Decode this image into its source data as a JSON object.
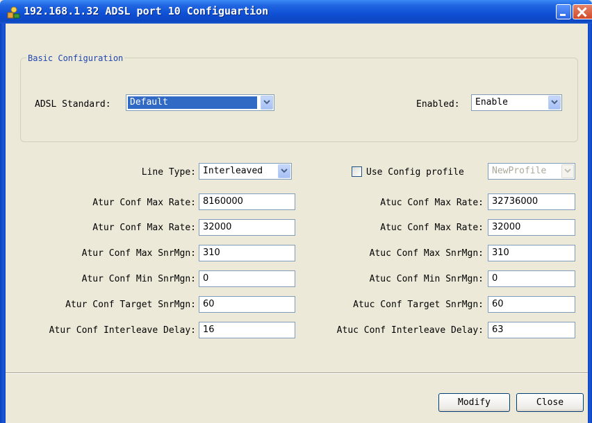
{
  "window": {
    "title": "192.168.1.32 ADSL port 10 Configuartion"
  },
  "basic": {
    "legend": "Basic Configuration",
    "standard_label": "ADSL Standard:",
    "standard_value": "Default",
    "enabled_label": "Enabled:",
    "enabled_value": "Enable"
  },
  "left": {
    "line_type_label": "Line Type:",
    "line_type_value": "Interleaved",
    "rows": [
      {
        "label": "Atur Conf Max Rate:",
        "value": "8160000"
      },
      {
        "label": "Atur Conf Max Rate:",
        "value": "32000"
      },
      {
        "label": "Atur Conf Max SnrMgn:",
        "value": "310"
      },
      {
        "label": "Atur Conf Min SnrMgn:",
        "value": "0"
      },
      {
        "label": "Atur Conf Target SnrMgn:",
        "value": "60"
      },
      {
        "label": "Atur Conf Interleave Delay:",
        "value": "16"
      }
    ]
  },
  "right": {
    "profile_label": "Use Config profile",
    "profile_checked": false,
    "profile_value": "NewProfile",
    "rows": [
      {
        "label": "Atuc Conf Max Rate:",
        "value": "32736000"
      },
      {
        "label": "Atuc Conf Max Rate:",
        "value": "32000"
      },
      {
        "label": "Atuc Conf Max SnrMgn:",
        "value": "310"
      },
      {
        "label": "Atuc Conf Min SnrMgn:",
        "value": "0"
      },
      {
        "label": "Atuc Conf Target SnrMgn:",
        "value": "60"
      },
      {
        "label": "Atuc Conf Interleave Delay:",
        "value": "63"
      }
    ]
  },
  "buttons": {
    "modify": "Modify",
    "close": "Close"
  },
  "colors": {
    "titlebar": "#0e4fd4",
    "background": "#ece9d8",
    "selection": "#316ac5",
    "legend_text": "#2046b0"
  },
  "icons": {
    "title": "app-icon",
    "dropdown": "chevron-down-icon"
  }
}
